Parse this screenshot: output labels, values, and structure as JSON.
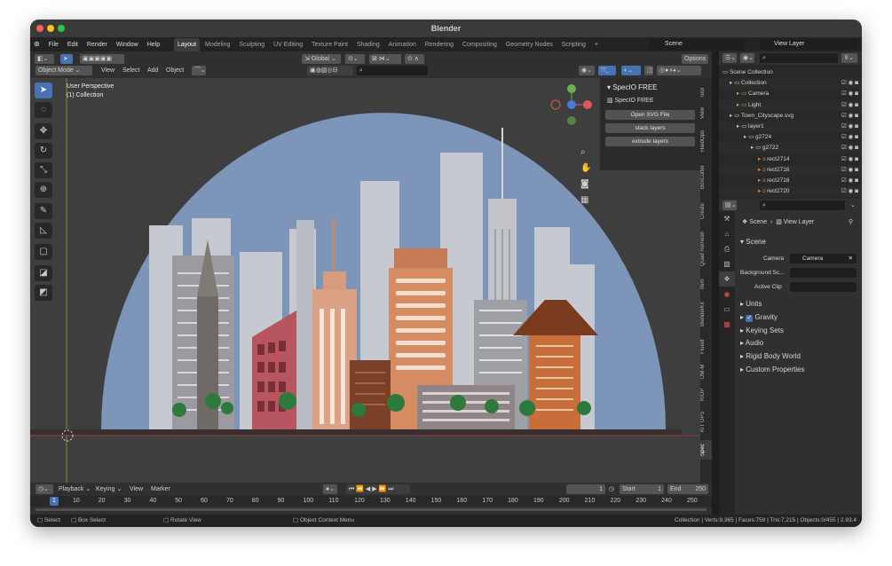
{
  "window": {
    "title": "Blender"
  },
  "menu": [
    "File",
    "Edit",
    "Render",
    "Window",
    "Help"
  ],
  "workspaces": [
    "Layout",
    "Modeling",
    "Sculpting",
    "UV Editing",
    "Texture Paint",
    "Shading",
    "Animation",
    "Rendering",
    "Compositing",
    "Geometry Nodes",
    "Scripting"
  ],
  "active_workspace": "Layout",
  "scene_field": "Scene",
  "view_layer_field": "View Layer",
  "viewport_header": {
    "mode": "Object Mode",
    "menus": [
      "View",
      "Select",
      "Add",
      "Object"
    ],
    "transform_orientation": "Global",
    "options": "Options"
  },
  "viewport": {
    "perspective": "User Perspective",
    "collection": "(1) Collection"
  },
  "npanel": {
    "header": "SpecIO FREE",
    "subheader": "SpecIO FREE",
    "buttons": [
      "Open SVG File",
      "stack layers",
      "extrude layers"
    ],
    "tabs": [
      "Tool",
      "View",
      "HardOps",
      "BoxCutter",
      "Create",
      "Quad Remesh",
      "Item",
      "BlenderKit",
      "Fluent",
      "DM-M",
      "KIOP",
      "KIT OPS",
      "Spec"
    ]
  },
  "timeline": {
    "menus": [
      "Playback",
      "Keying",
      "View",
      "Marker"
    ],
    "current_frame": "1",
    "start_label": "Start",
    "start": "1",
    "end_label": "End",
    "end": "250",
    "ruler": [
      "1",
      "10",
      "20",
      "30",
      "40",
      "50",
      "60",
      "70",
      "80",
      "90",
      "100",
      "110",
      "120",
      "130",
      "140",
      "150",
      "160",
      "170",
      "180",
      "190",
      "200",
      "210",
      "220",
      "230",
      "240",
      "250"
    ]
  },
  "outliner": {
    "rows": [
      {
        "label": "Scene Collection",
        "indent": 0
      },
      {
        "label": "Collection",
        "indent": 1
      },
      {
        "label": "Camera",
        "indent": 2
      },
      {
        "label": "Light",
        "indent": 2
      },
      {
        "label": "Town_Cityscape.svg",
        "indent": 1
      },
      {
        "label": "layer1",
        "indent": 2
      },
      {
        "label": "g2724",
        "indent": 3
      },
      {
        "label": "g2722",
        "indent": 4
      },
      {
        "label": "rect2714",
        "indent": 5
      },
      {
        "label": "rect2716",
        "indent": 5
      },
      {
        "label": "rect2718",
        "indent": 5
      },
      {
        "label": "rect2720",
        "indent": 5
      }
    ]
  },
  "properties": {
    "breadcrumb_scene": "Scene",
    "breadcrumb_layer": "View Layer",
    "panel_title": "Scene",
    "camera_label": "Camera",
    "camera_value": "Camera",
    "background_label": "Background Sc...",
    "clip_label": "Active Clip",
    "sections": [
      "Units",
      "Gravity",
      "Keying Sets",
      "Audio",
      "Rigid Body World",
      "Custom Properties"
    ]
  },
  "statusbar": {
    "select": "Select",
    "box_select": "Box Select",
    "rotate": "Rotate View",
    "context": "Object Context Menu",
    "stats": "Collection | Verts:9,365 | Faces:759 | Tris:7,215 | Objects:0/455 | 2.93.4"
  },
  "colors": {
    "accent": "#4772b3",
    "sky": "#7d95b8",
    "ground": "#3a2f2f"
  }
}
